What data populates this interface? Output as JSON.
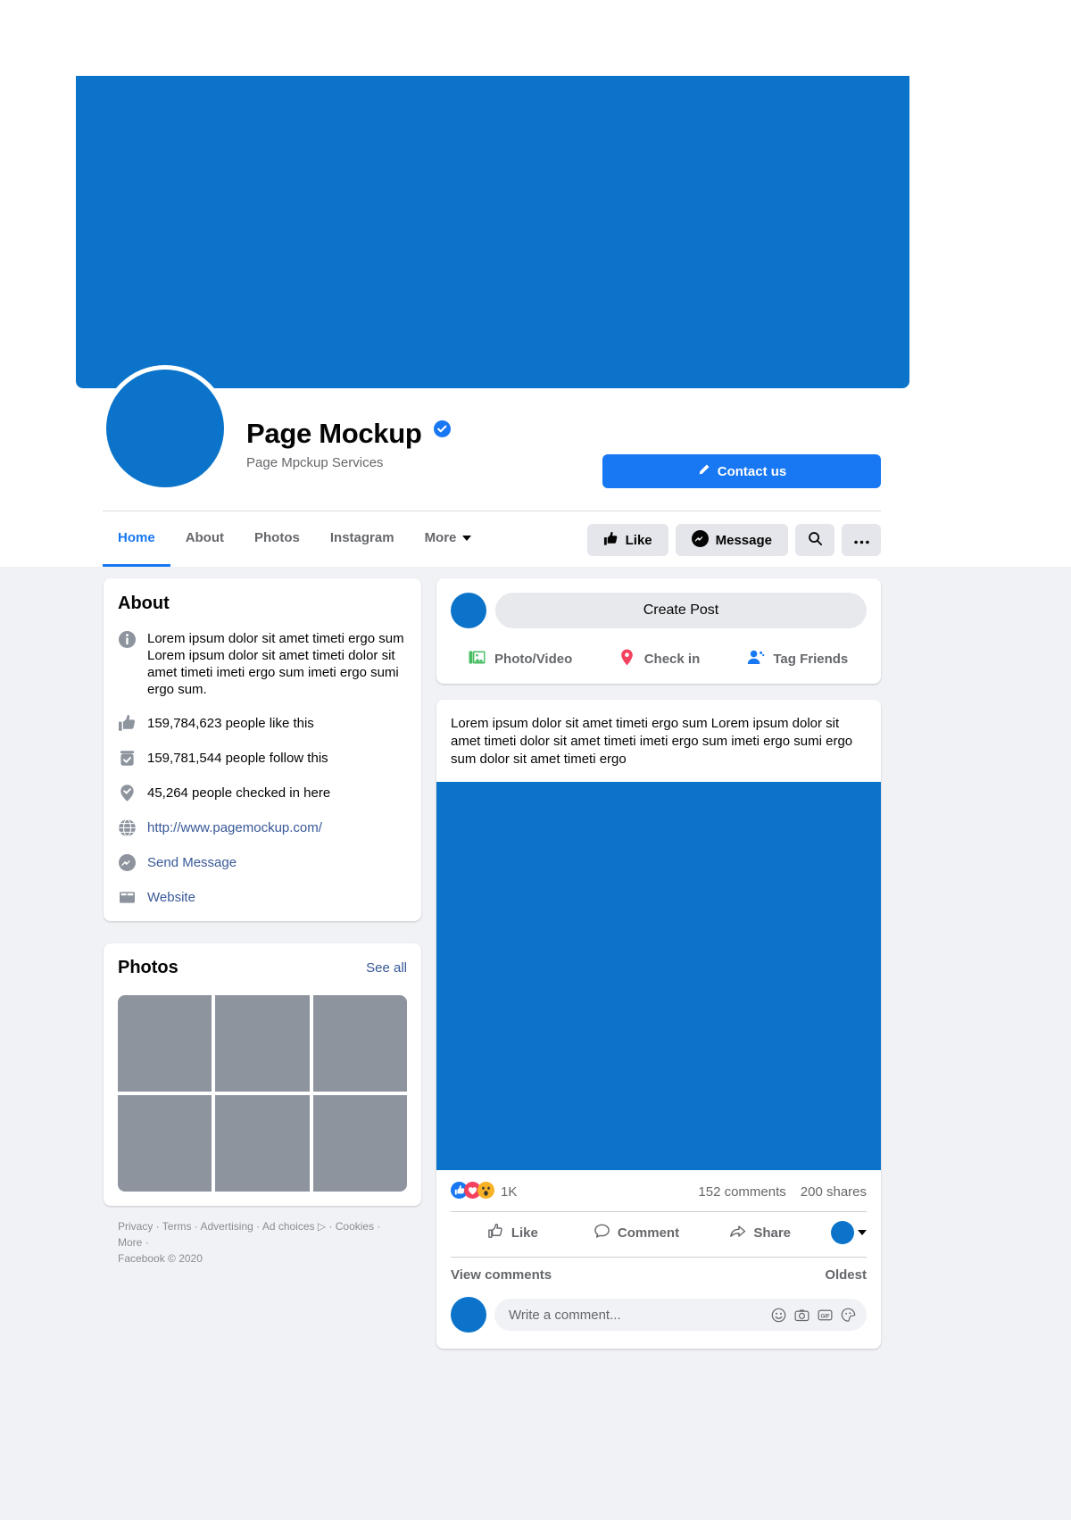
{
  "profile": {
    "name": "Page Mockup",
    "subtitle": "Page Mpckup Services",
    "verified_icon": "verified-badge-icon",
    "contact_button": "Contact us",
    "contact_icon": "pencil-icon"
  },
  "nav": {
    "tabs": [
      {
        "label": "Home",
        "active": true
      },
      {
        "label": "About",
        "active": false
      },
      {
        "label": "Photos",
        "active": false
      },
      {
        "label": "Instagram",
        "active": false
      },
      {
        "label": "More",
        "active": false,
        "caret": true
      }
    ],
    "actions": {
      "like": "Like",
      "message": "Message",
      "search_icon": "search-icon",
      "more_icon": "ellipsis-icon"
    }
  },
  "about": {
    "title": "About",
    "description": "Lorem ipsum dolor sit amet timeti ergo sum Lorem ipsum dolor sit amet timeti dolor sit amet timeti imeti ergo sum imeti ergo sumi ergo sum.",
    "likes": "159,784,623 people like this",
    "follows": "159,781,544 people follow this",
    "checkins": "45,264 people checked in here",
    "website_url": "http://www.pagemockup.com/",
    "send_message": "Send Message",
    "website_label": "Website"
  },
  "photos": {
    "title": "Photos",
    "see_all": "See all",
    "cells": [
      1,
      2,
      3,
      4,
      5,
      6
    ]
  },
  "footer": {
    "links": [
      "Privacy",
      "Terms",
      "Advertising",
      "Ad choices",
      "Cookies",
      "More"
    ],
    "line1": "Privacy · Terms · Advertising · Ad choices ▷ · Cookies · More ·",
    "line2": "Facebook © 2020"
  },
  "composer": {
    "placeholder": "Create Post",
    "photo_video": "Photo/Video",
    "check_in": "Check in",
    "tag_friends": "Tag Friends"
  },
  "post": {
    "text": "Lorem ipsum dolor sit amet timeti ergo sum Lorem ipsum dolor sit amet timeti dolor sit amet timeti imeti ergo sum imeti ergo sumi ergo sum  dolor sit amet timeti ergo",
    "reaction_count": "1K",
    "comments_count": "152 comments",
    "shares_count": "200 shares",
    "like": "Like",
    "comment": "Comment",
    "share": "Share",
    "view_comments": "View comments",
    "sort": "Oldest",
    "comment_placeholder": "Write a comment..."
  },
  "colors": {
    "brand_blue": "#1877f2",
    "cover_blue": "#0b74ca",
    "page_bg": "#f0f2f5",
    "link_blue": "#385898",
    "muted": "#65676b",
    "photo_gray": "#8d949e"
  }
}
